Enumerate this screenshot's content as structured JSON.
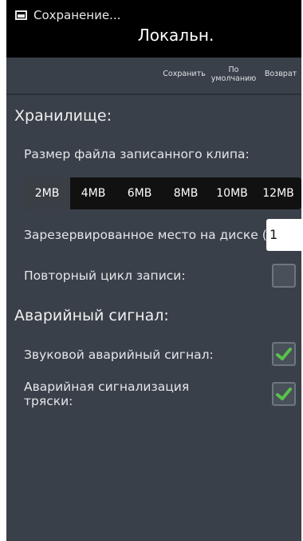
{
  "status_bar": {
    "app_notification": "Сохранение...",
    "icon": "image-icon"
  },
  "header": {
    "title": "Локальн."
  },
  "action_bar": {
    "save": "Сохранить",
    "default_line1": "По",
    "default_line2": "умолчанию",
    "back": "Возврат"
  },
  "storage": {
    "section_title": "Хранилище:",
    "clip_size_label": "Размер файла записанного клипа:",
    "clip_size_options": [
      "2MB",
      "4MB",
      "6MB",
      "8MB",
      "10MB",
      "12MB"
    ],
    "clip_size_selected": "2MB",
    "reserved_label": "Зарезервированное место на диске (MB):",
    "reserved_value": "1",
    "loop_label": "Повторный цикл записи:",
    "loop_checked": false
  },
  "alarm": {
    "section_title": "Аварийный сигнал:",
    "sound_label": "Звуковой аварийный сигнал:",
    "sound_checked": true,
    "shake_label_line1": "Аварийная сигнализация",
    "shake_label_line2": "тряски:",
    "shake_checked": true
  },
  "colors": {
    "background": "#394049",
    "status_bar": "#000000",
    "check_green": "#5bc24b",
    "segment_bg": "#111111"
  }
}
